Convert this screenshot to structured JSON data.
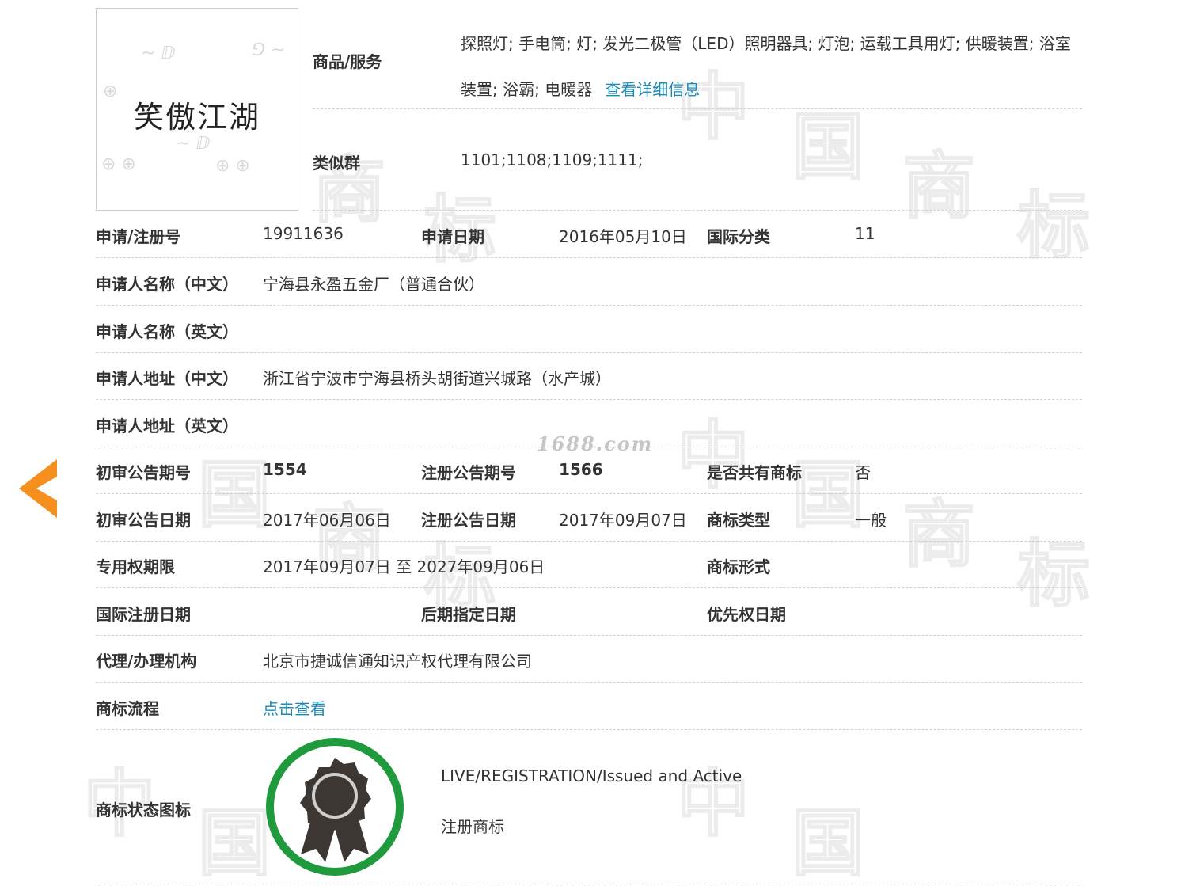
{
  "watermark": {
    "site": "1688.com",
    "glyphs": [
      "中",
      "国",
      "商",
      "标"
    ]
  },
  "logo": {
    "text": "笑傲江湖"
  },
  "goods": {
    "label": "商品/服务",
    "text": "探照灯; 手电筒; 灯; 发光二极管（LED）照明器具; 灯泡; 运载工具用灯; 供暖装置; 浴室装置; 浴霸; 电暖器",
    "detail_link": "查看详细信息"
  },
  "similar_group": {
    "label": "类似群",
    "value": "1101;1108;1109;1111;"
  },
  "rows": {
    "reg": {
      "reg_no_label": "申请/注册号",
      "reg_no": "19911636",
      "apply_date_label": "申请日期",
      "apply_date": "2016年05月10日",
      "intl_class_label": "国际分类",
      "intl_class": "11"
    },
    "applicant_cn": {
      "label": "申请人名称（中文）",
      "value": "宁海县永盈五金厂（普通合伙）"
    },
    "applicant_en": {
      "label": "申请人名称（英文）",
      "value": ""
    },
    "address_cn": {
      "label": "申请人地址（中文）",
      "value": "浙江省宁波市宁海县桥头胡街道兴城路（水产城）"
    },
    "address_en": {
      "label": "申请人地址（英文）",
      "value": ""
    },
    "gazette_no": {
      "prelim_label": "初审公告期号",
      "prelim": "1554",
      "reg_label": "注册公告期号",
      "reg": "1566",
      "shared_label": "是否共有商标",
      "shared": "否"
    },
    "gazette_date": {
      "prelim_label": "初审公告日期",
      "prelim": "2017年06月06日",
      "reg_label": "注册公告日期",
      "reg": "2017年09月07日",
      "type_label": "商标类型",
      "type": "一般"
    },
    "term": {
      "label": "专用权期限",
      "value": "2017年09月07日 至 2027年09月06日",
      "form_label": "商标形式",
      "form": ""
    },
    "intl": {
      "intl_date_label": "国际注册日期",
      "intl_date": "",
      "later_label": "后期指定日期",
      "later": "",
      "priority_label": "优先权日期",
      "priority": ""
    },
    "agent": {
      "label": "代理/办理机构",
      "value": "北京市捷诚信通知识产权代理有限公司"
    },
    "flow": {
      "label": "商标流程",
      "link": "点击查看"
    }
  },
  "status": {
    "label": "商标状态图标",
    "english": "LIVE/REGISTRATION/Issued and Active",
    "chinese": "注册商标",
    "ring_color": "#1f9a3c",
    "medal_color": "#3d3734"
  },
  "colors": {
    "link": "#1a8ab8",
    "arrow": "#f5901e"
  }
}
